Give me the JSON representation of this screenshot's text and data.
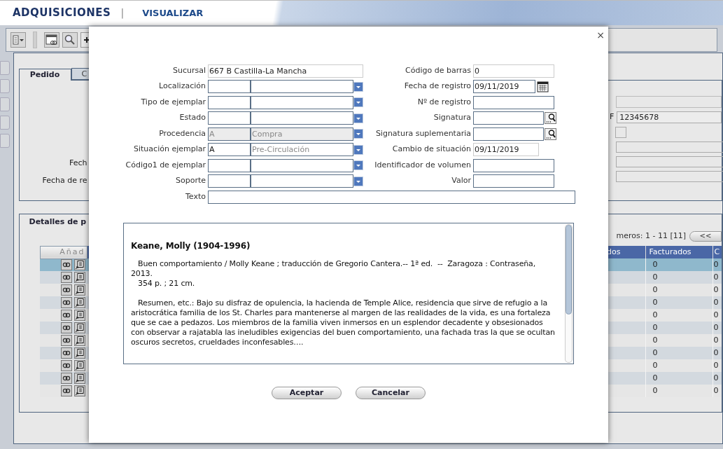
{
  "header": {
    "title": "ADQUISICIONES",
    "separator": "|",
    "section": "VISUALIZAR"
  },
  "background": {
    "tabs": [
      {
        "label": "Pedido",
        "selected": true
      },
      {
        "label": "C",
        "selected": false
      }
    ],
    "order_labels": [
      "Fech",
      "Fecha de re"
    ],
    "id_label": "F",
    "id_value": "12345678",
    "details": {
      "title": "Detalles de p",
      "pager": "meros: 1 - 11 [11]",
      "pager_button": "<<",
      "columns": [
        "Añad",
        "dos",
        "Facturados",
        "C"
      ],
      "rows": [
        {
          "selected": true,
          "facturados": "0",
          "column_4": "0"
        },
        {
          "selected": false,
          "facturados": "0",
          "column_4": "0"
        },
        {
          "selected": false,
          "facturados": "0",
          "column_4": "0"
        },
        {
          "selected": false,
          "facturados": "0",
          "column_4": "0"
        },
        {
          "selected": false,
          "facturados": "0",
          "column_4": "0"
        },
        {
          "selected": false,
          "facturados": "0",
          "column_4": "0"
        },
        {
          "selected": false,
          "facturados": "0",
          "column_4": "0"
        },
        {
          "selected": false,
          "facturados": "0",
          "column_4": "0"
        },
        {
          "selected": false,
          "facturados": "0",
          "column_4": "0"
        },
        {
          "selected": false,
          "facturados": "0",
          "column_4": "0"
        },
        {
          "selected": false,
          "facturados": "0",
          "column_4": "0"
        }
      ]
    }
  },
  "dialog": {
    "close": "×",
    "left_fields": [
      {
        "label": "Sucursal",
        "kind": "text",
        "value": "667 B Castilla-La Mancha"
      },
      {
        "label": "Localización",
        "kind": "combo",
        "disabled": false
      },
      {
        "label": "Tipo de ejemplar",
        "kind": "combo",
        "disabled": false
      },
      {
        "label": "Estado",
        "kind": "combo",
        "disabled": false
      },
      {
        "label": "Procedencia",
        "kind": "combo",
        "code": "A",
        "description": "Compra",
        "disabled": true
      },
      {
        "label": "Situación ejemplar",
        "kind": "combo",
        "code": "A",
        "description": "Pre-Circulación",
        "disabled": false
      },
      {
        "label": "Código1 de ejemplar",
        "kind": "combo",
        "disabled": false
      },
      {
        "label": "Soporte",
        "kind": "combo",
        "disabled": false
      }
    ],
    "right_fields": [
      {
        "label": "Código de barras",
        "kind": "text",
        "value": "0",
        "readonly": true
      },
      {
        "label": "Fecha de registro",
        "kind": "date_picker",
        "value": "09/11/2019",
        "readonly": false
      },
      {
        "label": "Nº de registro",
        "kind": "text",
        "readonly": false
      },
      {
        "label": "Signatura",
        "kind": "lookup",
        "readonly": false
      },
      {
        "label": "Signatura suplementaria",
        "kind": "lookup",
        "readonly": false
      },
      {
        "label": "Cambio de situación",
        "kind": "date",
        "value": "09/11/2019",
        "readonly": true
      },
      {
        "label": "Identificador de volumen",
        "kind": "text",
        "readonly": false
      },
      {
        "label": "Valor",
        "kind": "text",
        "readonly": false
      }
    ],
    "text_field": {
      "label": "Texto"
    },
    "record": {
      "heading": "Keane, Molly (1904-1996)",
      "description_lines": [
        "   Buen comportamiento / Molly Keane ; traducción de Gregorio Cantera.-- 1ª ed.  --  Zaragoza : Contraseña, 2013.",
        "   354 p. ; 21 cm."
      ],
      "summary": "   Resumen, etc.: Bajo su disfraz de opulencia, la hacienda de Temple Alice, residencia que sirve de refugio a la aristocrática familia de los St. Charles para mantenerse al margen de las realidades de la vida, es una fortaleza que se cae a pedazos. Los miembros de la familia viven inmersos en un esplendor decadente y obsesionados con observar a rajatabla las ineludibles exigencias del buen comportamiento, una fachada tras la que se ocultan oscuros secretos, crueldades inconfesables…."
    },
    "buttons": [
      "Aceptar",
      "Cancelar"
    ]
  }
}
